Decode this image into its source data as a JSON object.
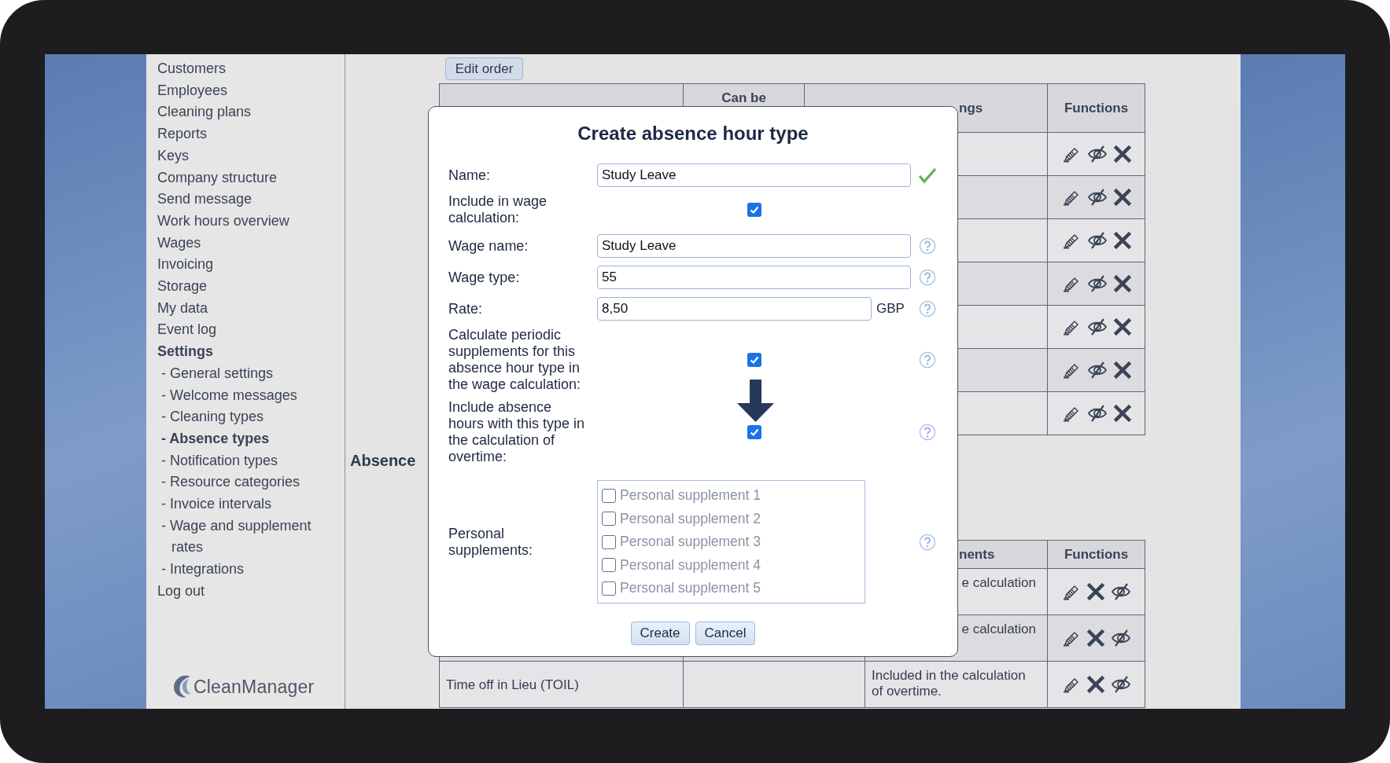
{
  "sidebar": {
    "items": [
      {
        "label": "Customers",
        "kind": "main",
        "selected": false
      },
      {
        "label": "Employees",
        "kind": "main",
        "selected": false
      },
      {
        "label": "Cleaning plans",
        "kind": "main",
        "selected": false
      },
      {
        "label": "Reports",
        "kind": "main",
        "selected": false
      },
      {
        "label": "Keys",
        "kind": "main",
        "selected": false
      },
      {
        "label": "Company structure",
        "kind": "main",
        "selected": false
      },
      {
        "label": "Send message",
        "kind": "main",
        "selected": false
      },
      {
        "label": "Work hours overview",
        "kind": "main",
        "selected": false
      },
      {
        "label": "Wages",
        "kind": "main",
        "selected": false
      },
      {
        "label": "Invoicing",
        "kind": "main",
        "selected": false
      },
      {
        "label": "Storage",
        "kind": "main",
        "selected": false
      },
      {
        "label": "My data",
        "kind": "main",
        "selected": false
      },
      {
        "label": "Event log",
        "kind": "main",
        "selected": false
      },
      {
        "label": "Settings",
        "kind": "main",
        "selected": true
      },
      {
        "label": "- General settings",
        "kind": "sub",
        "selected": false
      },
      {
        "label": "- Welcome messages",
        "kind": "sub",
        "selected": false
      },
      {
        "label": "- Cleaning types",
        "kind": "sub",
        "selected": false
      },
      {
        "label": "- Absence types",
        "kind": "sub",
        "selected": true
      },
      {
        "label": "- Notification types",
        "kind": "sub",
        "selected": false
      },
      {
        "label": "- Resource categories",
        "kind": "sub",
        "selected": false
      },
      {
        "label": "- Invoice intervals",
        "kind": "sub",
        "selected": false
      },
      {
        "label": "- Wage and supplement rates",
        "kind": "sub",
        "selected": false
      },
      {
        "label": "- Integrations",
        "kind": "sub",
        "selected": false
      },
      {
        "label": "Log out",
        "kind": "main",
        "selected": false
      }
    ],
    "logo": "CleanManager"
  },
  "toolbar": {
    "buttons": [
      "Edit order"
    ]
  },
  "wage_table": {
    "header": {
      "column_2": "Can be",
      "column_3": "ngs",
      "column_4": "Functions"
    },
    "rows": [
      {
        "actions": [
          {
            "kind": "edit"
          },
          {
            "kind": "hide"
          },
          {
            "kind": "delete"
          }
        ]
      },
      {
        "actions": [
          {
            "kind": "edit"
          },
          {
            "kind": "hide"
          },
          {
            "kind": "delete"
          }
        ]
      },
      {
        "actions": [
          {
            "kind": "edit"
          },
          {
            "kind": "hide"
          },
          {
            "kind": "delete"
          }
        ]
      },
      {
        "actions": [
          {
            "kind": "edit"
          },
          {
            "kind": "hide"
          },
          {
            "kind": "delete"
          }
        ]
      },
      {
        "actions": [
          {
            "kind": "edit"
          },
          {
            "kind": "hide"
          },
          {
            "kind": "delete"
          }
        ]
      },
      {
        "actions": [
          {
            "kind": "edit"
          },
          {
            "kind": "hide"
          },
          {
            "kind": "delete"
          }
        ]
      },
      {
        "actions": [
          {
            "kind": "edit"
          },
          {
            "kind": "hide"
          },
          {
            "kind": "delete"
          }
        ]
      }
    ]
  },
  "absence_section": {
    "title": "Absence",
    "table": {
      "header": {
        "column_3": "nents",
        "column_4": "Functions"
      },
      "rows": [
        {
          "column_3": "e calculation",
          "actions": [
            {
              "kind": "edit"
            },
            {
              "kind": "delete"
            },
            {
              "kind": "hide"
            }
          ]
        },
        {
          "column_3": "e calculation",
          "actions": [
            {
              "kind": "edit"
            },
            {
              "kind": "delete"
            },
            {
              "kind": "hide"
            }
          ]
        },
        {
          "name": "Time off in Lieu (TOIL)",
          "column_3": "Included in the calculation of overtime.",
          "actions": [
            {
              "kind": "edit"
            },
            {
              "kind": "delete"
            },
            {
              "kind": "hide"
            }
          ]
        }
      ]
    }
  },
  "dialog": {
    "title": "Create absence hour type",
    "fields": [
      {
        "kind": "text",
        "label": "Name:",
        "value": "Study Leave",
        "valid": true,
        "help": false
      },
      {
        "kind": "checkbox",
        "label": "Include in wage calculation:",
        "checked": true,
        "help": false
      },
      {
        "kind": "text",
        "label": "Wage name:",
        "value": "Study Leave",
        "help": true
      },
      {
        "kind": "text",
        "label": "Wage type:",
        "value": "55",
        "help": true
      },
      {
        "kind": "text",
        "label": "Rate:",
        "value": "8,50",
        "unit": "GBP",
        "help": true
      },
      {
        "kind": "checkbox",
        "label": "Calculate periodic supplements for this absence hour type in the wage calculation:",
        "checked": true,
        "help": true
      },
      {
        "kind": "checkbox",
        "label": "Include absence hours with this type in the calculation of overtime:",
        "checked": true,
        "help": true
      },
      {
        "kind": "checklist",
        "label": "Personal supplements:",
        "help": true,
        "options": [
          {
            "label": "Personal supplement 1",
            "checked": false,
            "disabled": true
          },
          {
            "label": "Personal supplement 2",
            "checked": false,
            "disabled": true
          },
          {
            "label": "Personal supplement 3",
            "checked": false,
            "disabled": true
          },
          {
            "label": "Personal supplement 4",
            "checked": false,
            "disabled": true
          },
          {
            "label": "Personal supplement 5",
            "checked": false,
            "disabled": true
          }
        ]
      }
    ],
    "buttons": [
      "Create",
      "Cancel"
    ]
  }
}
